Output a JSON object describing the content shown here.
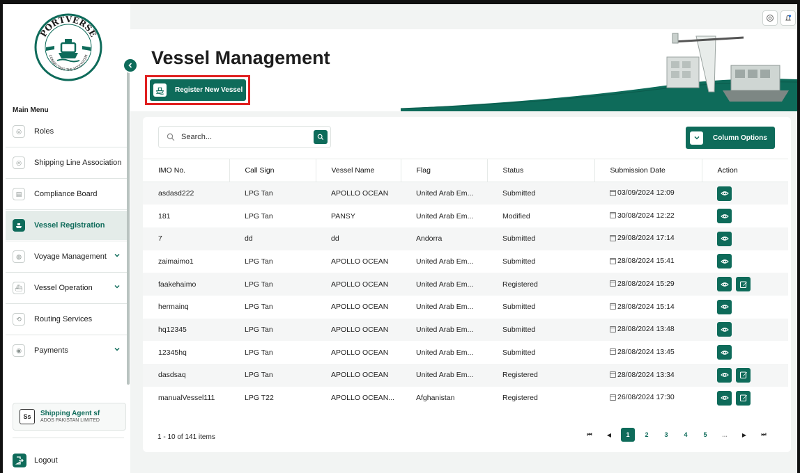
{
  "sidebar": {
    "logo": {
      "top_text": "PORTVERSE",
      "bottom_text": "CONNECTING THE ECOSYSTEM"
    },
    "menu_heading": "Main Menu",
    "items": [
      {
        "label": "Roles",
        "icon": "roles-icon"
      },
      {
        "label": "Shipping Line Association",
        "icon": "association-icon"
      },
      {
        "label": "Compliance Board",
        "icon": "compliance-icon"
      },
      {
        "label": "Vessel Registration",
        "icon": "ship-icon",
        "active": true
      },
      {
        "label": "Voyage Management",
        "icon": "voyage-icon",
        "expandable": true
      },
      {
        "label": "Vessel Operation",
        "icon": "operation-icon",
        "expandable": true
      },
      {
        "label": "Routing Services",
        "icon": "route-icon"
      },
      {
        "label": "Payments",
        "icon": "payments-icon",
        "expandable": true
      }
    ],
    "agent": {
      "initials": "Ss",
      "name": "Shipping Agent sf",
      "company": "ADOS PAKISTAN LIMITED"
    },
    "logout_label": "Logout"
  },
  "header": {
    "title": "Vessel Management",
    "register_button": "Register New Vessel"
  },
  "toolbar": {
    "search_placeholder": "Search...",
    "column_options": "Column Options"
  },
  "table": {
    "columns": [
      "IMO No.",
      "Call Sign",
      "Vessel Name",
      "Flag",
      "Status",
      "Submission Date",
      "Action"
    ],
    "rows": [
      {
        "imo": "asdasd222",
        "call_sign": "LPG Tan",
        "vessel_name": "APOLLO OCEAN",
        "flag": "United Arab Em...",
        "status": "Submitted",
        "date": "03/09/2024 12:09",
        "editable": false
      },
      {
        "imo": "181",
        "call_sign": "LPG Tan",
        "vessel_name": "PANSY",
        "flag": "United Arab Em...",
        "status": "Modified",
        "date": "30/08/2024 12:22",
        "editable": false
      },
      {
        "imo": "7",
        "call_sign": "dd",
        "vessel_name": "dd",
        "flag": "Andorra",
        "status": "Submitted",
        "date": "29/08/2024 17:14",
        "editable": false
      },
      {
        "imo": "zaimaimo1",
        "call_sign": "LPG Tan",
        "vessel_name": "APOLLO OCEAN",
        "flag": "United Arab Em...",
        "status": "Submitted",
        "date": "28/08/2024 15:41",
        "editable": false
      },
      {
        "imo": "faakehaimo",
        "call_sign": "LPG Tan",
        "vessel_name": "APOLLO OCEAN",
        "flag": "United Arab Em...",
        "status": "Registered",
        "date": "28/08/2024 15:29",
        "editable": true
      },
      {
        "imo": "hermainq",
        "call_sign": "LPG Tan",
        "vessel_name": "APOLLO OCEAN",
        "flag": "United Arab Em...",
        "status": "Submitted",
        "date": "28/08/2024 15:14",
        "editable": false
      },
      {
        "imo": "hq12345",
        "call_sign": "LPG Tan",
        "vessel_name": "APOLLO OCEAN",
        "flag": "United Arab Em...",
        "status": "Submitted",
        "date": "28/08/2024 13:48",
        "editable": false
      },
      {
        "imo": "12345hq",
        "call_sign": "LPG Tan",
        "vessel_name": "APOLLO OCEAN",
        "flag": "United Arab Em...",
        "status": "Submitted",
        "date": "28/08/2024 13:45",
        "editable": false
      },
      {
        "imo": "dasdsaq",
        "call_sign": "LPG Tan",
        "vessel_name": "APOLLO OCEAN",
        "flag": "United Arab Em...",
        "status": "Registered",
        "date": "28/08/2024 13:34",
        "editable": true
      },
      {
        "imo": "manualVessel111",
        "call_sign": "LPG T22",
        "vessel_name": "APOLLO OCEAN...",
        "flag": "Afghanistan",
        "status": "Registered",
        "date": "26/08/2024 17:30",
        "editable": true
      }
    ]
  },
  "pagination": {
    "summary": "1 - 10 of 141 items",
    "pages": [
      "1",
      "2",
      "3",
      "4",
      "5",
      "..."
    ],
    "current": "1"
  },
  "colors": {
    "brand": "#0e6b5a",
    "highlight": "#e02020"
  }
}
